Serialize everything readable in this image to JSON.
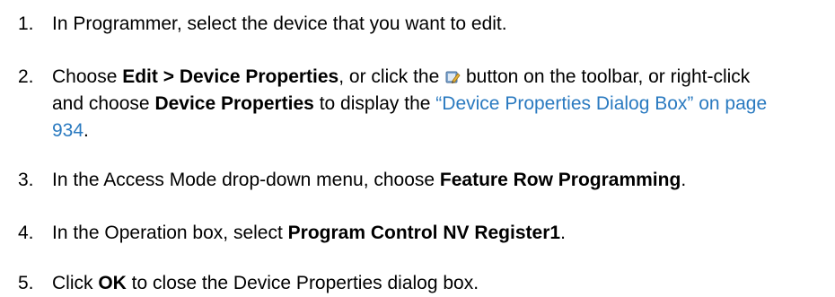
{
  "steps": [
    {
      "num": "1.",
      "text": "In Programmer, select the device that you want to edit."
    },
    {
      "num": "2.",
      "t1": "Choose ",
      "b1": "Edit > Device Properties",
      "t2": ", or click the ",
      "icon": "device-properties-icon",
      "t3": " button on the toolbar, or right-click and choose ",
      "b2": "Device Properties",
      "t4": " to display the ",
      "link": "“Device Properties Dialog Box” on page 934",
      "t5": "."
    },
    {
      "num": "3.",
      "t1": "In the Access Mode drop-down menu, choose ",
      "b1": "Feature Row Programming",
      "t2": "."
    },
    {
      "num": "4.",
      "t1": "In the Operation box, select ",
      "b1": "Program Control NV Register1",
      "t2": "."
    },
    {
      "num": "5.",
      "t1": "Click ",
      "b1": "OK",
      "t2": " to close the Device Properties dialog box."
    }
  ],
  "colors": {
    "text": "#000000",
    "link": "#2a7ac0"
  }
}
